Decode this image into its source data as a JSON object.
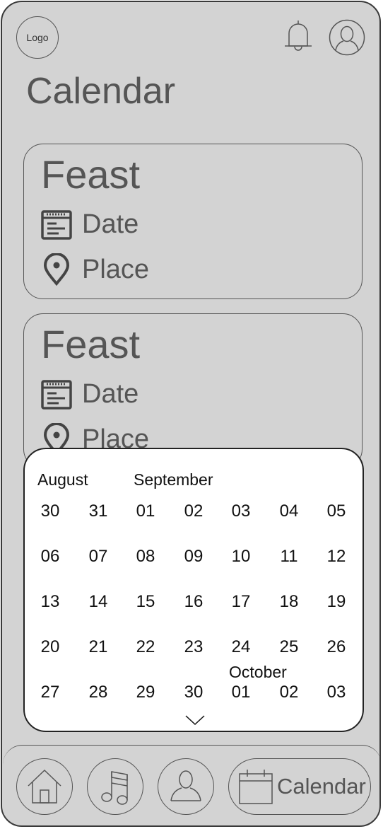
{
  "header": {
    "logo": "Logo",
    "title": "Calendar"
  },
  "events": [
    {
      "title": "Feast",
      "date_label": "Date",
      "place_label": "Place"
    },
    {
      "title": "Feast",
      "date_label": "Date",
      "place_label": "Place"
    }
  ],
  "calendar": {
    "months": [
      "August",
      "September",
      "October"
    ],
    "weeks": [
      [
        "30",
        "31",
        "01",
        "02",
        "03",
        "04",
        "05"
      ],
      [
        "06",
        "07",
        "08",
        "09",
        "10",
        "11",
        "12"
      ],
      [
        "13",
        "14",
        "15",
        "16",
        "17",
        "18",
        "19"
      ],
      [
        "20",
        "21",
        "22",
        "23",
        "24",
        "25",
        "26"
      ],
      [
        "27",
        "28",
        "29",
        "30",
        "01",
        "02",
        "03"
      ]
    ]
  },
  "nav": {
    "calendar_label": "Calendar"
  },
  "icons": [
    "bell-icon",
    "user-icon",
    "date-icon",
    "location-pin-icon",
    "chevron-down-icon",
    "home-icon",
    "music-icon",
    "calendar-icon"
  ]
}
